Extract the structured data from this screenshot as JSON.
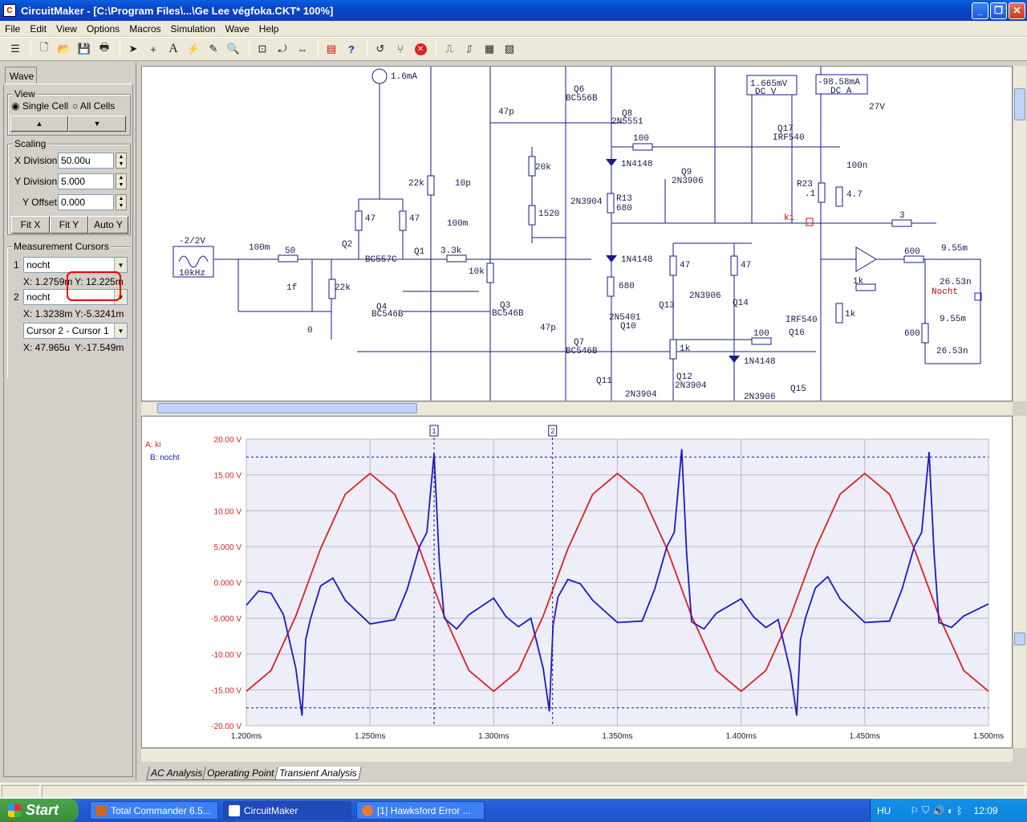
{
  "window": {
    "title": "CircuitMaker - [C:\\Program Files\\...\\Ge Lee végfoka.CKT* 100%]",
    "icon": "circuitmaker-icon"
  },
  "menu": [
    "File",
    "Edit",
    "View",
    "Options",
    "Macros",
    "Simulation",
    "Wave",
    "Help"
  ],
  "panel": {
    "tab": "Wave",
    "view": {
      "label": "View",
      "single": "Single Cell",
      "all": "All Cells",
      "up": "▲",
      "down": "▼"
    },
    "scaling": {
      "label": "Scaling",
      "xdiv_label": "X Division",
      "xdiv": "50.00u",
      "ydiv_label": "Y Division",
      "ydiv": "5.000",
      "yoff_label": "Y Offset",
      "yoff": "0.000",
      "fitx": "Fit X",
      "fity": "Fit Y",
      "autoy": "Auto Y"
    },
    "cursors": {
      "label": "Measurement Cursors",
      "c1_num": "1",
      "c1_sel": "nocht",
      "c1_x": "X: 1.2759m",
      "c1_y": "Y: 12.225m",
      "c2_num": "2",
      "c2_sel": "nocht",
      "c2_x": "X: 1.3238m",
      "c2_y": "Y:-5.3241m",
      "diff_sel": "Cursor 2 - Cursor 1",
      "diff_x": "X: 47.965u",
      "diff_y": "Y:-17.549m"
    }
  },
  "schematic": {
    "labels": [
      "1.6mA",
      "Q6",
      "BC556B",
      "47p",
      "Q8",
      "2N5551",
      "1.665mV",
      "DC V",
      "-98.58mA",
      "DC A",
      "27V",
      "Q17",
      "IRF540",
      "100",
      "20k",
      "1N4148",
      "Q9",
      "2N3906",
      "100n",
      "22k",
      "10p",
      "2N3904",
      "R13",
      "680",
      "R23",
      ".1",
      "4.7",
      "ki",
      "3",
      "1520",
      "100m",
      "-2/2V",
      "10kHz",
      "100m",
      "50",
      "Q2",
      "BC557C",
      "47",
      "47",
      "Q1",
      "3.3k",
      "10k",
      "1N4148",
      "47",
      "47",
      "600",
      "9.55m",
      "1f",
      "22k",
      "680",
      "2N3906",
      "Q13",
      "Q14",
      "1k",
      "26.53n",
      "Nocht",
      "Q4",
      "BC546B",
      "Q3",
      "BC546B",
      "2N5401",
      "Q10",
      "IRF540",
      "Q16",
      "1k",
      "9.55m",
      "0",
      "47p",
      "100",
      "600",
      "Q7",
      "BC546B",
      "1k",
      "1N4148",
      "26.53n",
      "Q11",
      "2N3904",
      "Q12",
      "2N3904",
      "2N3906",
      "Q15"
    ]
  },
  "wave": {
    "legend": [
      {
        "name": "A: ki",
        "color": "#e02020"
      },
      {
        "name": "B: nocht",
        "color": "#1a1acc"
      }
    ],
    "cursor_labels": [
      "1",
      "2"
    ]
  },
  "chart_data": {
    "type": "line",
    "xlabel": "",
    "ylabel": "",
    "xlim": [
      1.2,
      1.5
    ],
    "ylim": [
      -20,
      20
    ],
    "x_ticks": [
      "1.200ms",
      "1.250ms",
      "1.300ms",
      "1.350ms",
      "1.400ms",
      "1.450ms",
      "1.500ms"
    ],
    "y_ticks": [
      "20.00 V",
      "15.00 V",
      "10.00 V",
      "5.000 V",
      "0.000 V",
      "-5.000 V",
      "-10.00 V",
      "-15.00 V",
      "-20.00 V"
    ],
    "series": [
      {
        "name": "A: ki",
        "color": "#e02020",
        "x": [
          1.2,
          1.21,
          1.22,
          1.23,
          1.24,
          1.25,
          1.26,
          1.27,
          1.28,
          1.29,
          1.3,
          1.31,
          1.32,
          1.33,
          1.34,
          1.35,
          1.36,
          1.37,
          1.38,
          1.39,
          1.4,
          1.41,
          1.42,
          1.43,
          1.44,
          1.45,
          1.46,
          1.47,
          1.48,
          1.49,
          1.5
        ],
        "y": [
          -15.2,
          -12.3,
          -4.7,
          4.7,
          12.3,
          15.2,
          12.3,
          4.7,
          -4.7,
          -12.3,
          -15.2,
          -12.3,
          -4.7,
          4.7,
          12.3,
          15.2,
          12.3,
          4.7,
          -4.7,
          -12.3,
          -15.2,
          -12.3,
          -4.7,
          4.7,
          12.3,
          15.2,
          12.3,
          4.7,
          -4.7,
          -12.3,
          -15.2
        ]
      },
      {
        "name": "B: nocht",
        "color": "#1a1acc",
        "x": [
          1.2,
          1.205,
          1.21,
          1.215,
          1.22,
          1.2225,
          1.224,
          1.226,
          1.23,
          1.235,
          1.24,
          1.25,
          1.26,
          1.265,
          1.27,
          1.273,
          1.2759,
          1.278,
          1.28,
          1.285,
          1.29,
          1.3,
          1.305,
          1.31,
          1.315,
          1.32,
          1.3225,
          1.324,
          1.326,
          1.33,
          1.335,
          1.34,
          1.35,
          1.36,
          1.365,
          1.37,
          1.373,
          1.376,
          1.378,
          1.38,
          1.385,
          1.39,
          1.4,
          1.405,
          1.41,
          1.415,
          1.42,
          1.4225,
          1.424,
          1.426,
          1.43,
          1.435,
          1.44,
          1.45,
          1.46,
          1.465,
          1.47,
          1.473,
          1.476,
          1.478,
          1.48,
          1.485,
          1.49,
          1.5
        ],
        "y": [
          -3.2,
          -1.2,
          -1.5,
          -4.5,
          -12,
          -18.6,
          -8,
          -5,
          -0.5,
          0.6,
          -2.5,
          -5.8,
          -5.2,
          -1,
          5,
          7,
          18,
          3,
          -5,
          -6.5,
          -4.5,
          -2.2,
          -4.8,
          -6.2,
          -5,
          -12,
          -18,
          -6,
          -2,
          0.4,
          -0.2,
          -2.5,
          -5.6,
          -5.4,
          -1,
          5,
          7,
          18.6,
          4,
          -5.5,
          -6.5,
          -4.3,
          -2.3,
          -4.8,
          -6.3,
          -5.2,
          -12.5,
          -18.6,
          -8,
          -5,
          -0.8,
          0.8,
          -2.3,
          -5.6,
          -5.4,
          -1,
          5,
          7,
          18.2,
          4,
          -5.6,
          -6.3,
          -4.7,
          -3
        ]
      }
    ]
  },
  "bottom_tabs": [
    "AC Analysis",
    "Operating Point",
    "Transient Analysis"
  ],
  "taskbar": {
    "start": "Start",
    "tasks": [
      "Total Commander 6.5...",
      "CircuitMaker",
      "[1] Hawksford Error ..."
    ],
    "lang": "HU",
    "clock": "12:09"
  }
}
